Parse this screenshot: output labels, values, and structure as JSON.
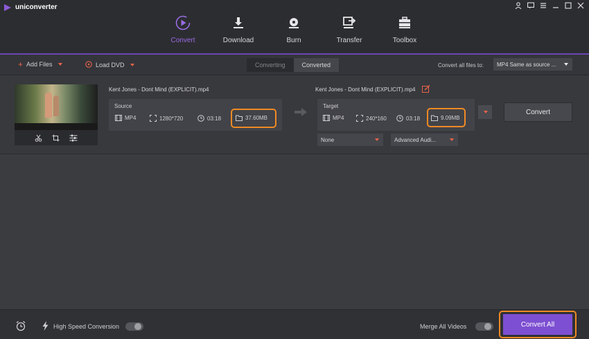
{
  "app": {
    "title": "uniconverter",
    "brand_color": "#8b5bd6"
  },
  "window_controls": [
    "user-icon",
    "message-icon",
    "menu-icon",
    "minimize-icon",
    "maximize-icon",
    "close-icon"
  ],
  "nav": {
    "items": [
      {
        "label": "Convert",
        "icon": "convert-icon",
        "active": true
      },
      {
        "label": "Download",
        "icon": "download-icon",
        "active": false
      },
      {
        "label": "Burn",
        "icon": "burn-icon",
        "active": false
      },
      {
        "label": "Transfer",
        "icon": "transfer-icon",
        "active": false
      },
      {
        "label": "Toolbox",
        "icon": "toolbox-icon",
        "active": false
      }
    ]
  },
  "toolbar": {
    "add_files": "Add Files",
    "load_dvd": "Load DVD",
    "tabs": [
      "Converting",
      "Converted"
    ],
    "convert_all_to_label": "Convert all files to:",
    "convert_all_to_value": "MP4 Same as source ..."
  },
  "file": {
    "source_name": "Kent Jones - Dont Mind (EXPLICIT).mp4",
    "target_name": "Kent Jones - Dont Mind (EXPLICIT).mp4",
    "source": {
      "title": "Source",
      "format": "MP4",
      "resolution": "1280*720",
      "duration": "03:18",
      "size": "37.60MB"
    },
    "target": {
      "title": "Target",
      "format": "MP4",
      "resolution": "240*160",
      "duration": "03:18",
      "size": "9.09MB"
    },
    "convert_label": "Convert",
    "subtitle": "None",
    "audio": "Advanced Audi..."
  },
  "bottom": {
    "high_speed": "High Speed Conversion",
    "merge": "Merge All Videos",
    "convert_all": "Convert All"
  },
  "colors": {
    "highlight": "#f08a24",
    "accent": "#7d4fd2",
    "caret": "#e8634a"
  }
}
